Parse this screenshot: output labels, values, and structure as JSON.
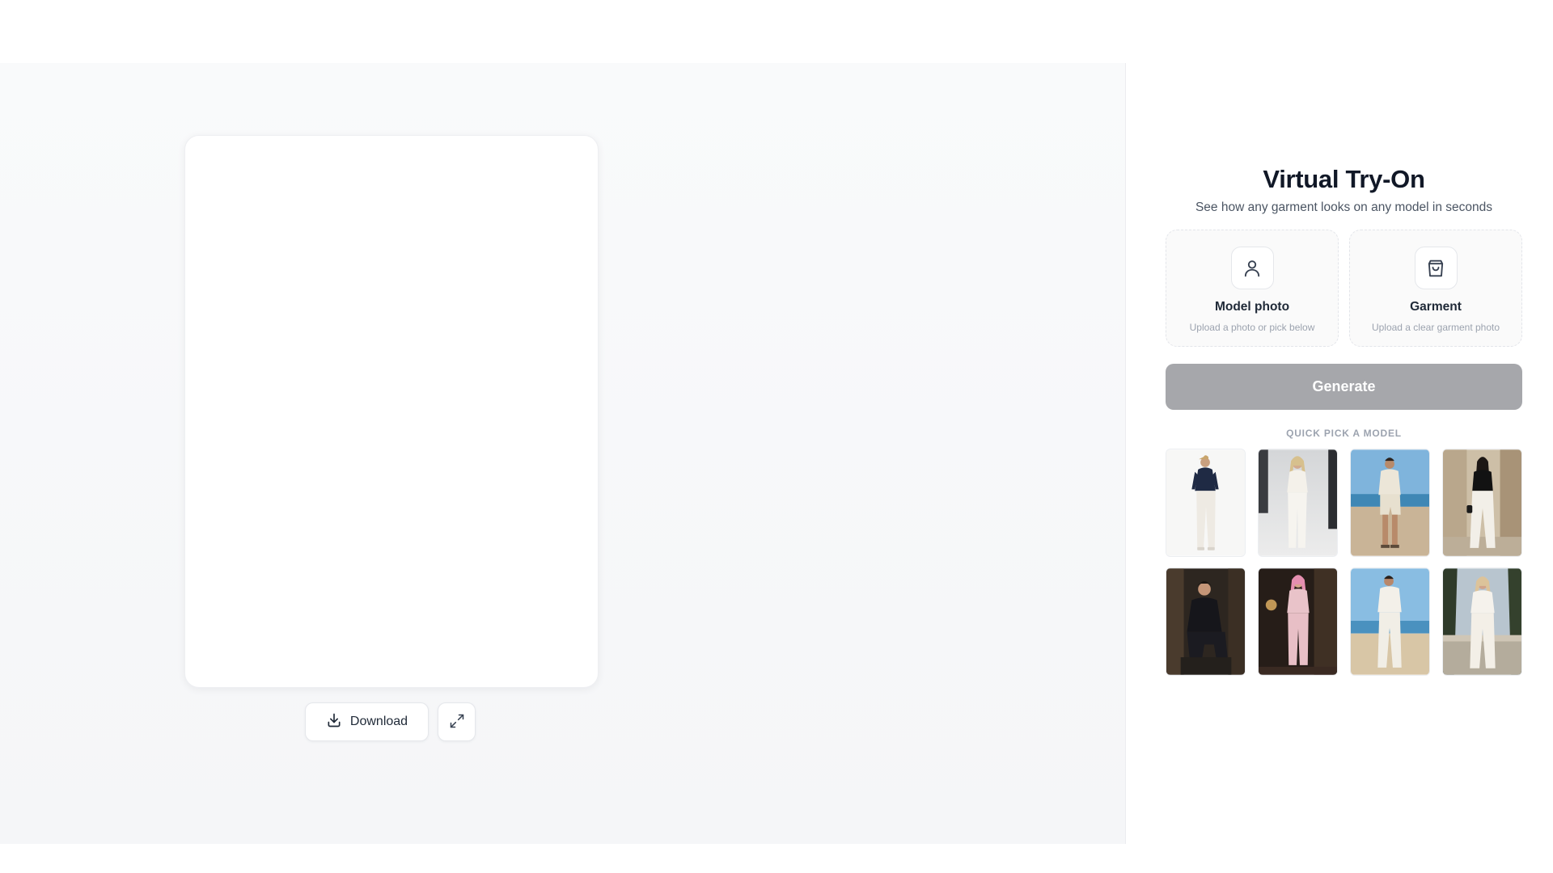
{
  "preview": {
    "download_label": "Download",
    "icons": {
      "download": "download-icon",
      "expand": "expand-icon"
    }
  },
  "panel": {
    "title": "Virtual Try-On",
    "subtitle": "See how any garment looks on any model in seconds",
    "uploads": [
      {
        "title": "Model photo",
        "subtitle": "Upload a photo or pick below",
        "icon": "user-icon"
      },
      {
        "title": "Garment",
        "subtitle": "Upload a clear garment photo",
        "icon": "shopping-bag-icon"
      }
    ],
    "generate_label": "Generate",
    "quick_pick_label": "QUICK PICK A MODEL",
    "models": [
      {
        "scene": "white studio",
        "top": "navy shirt",
        "bottom": "white trousers"
      },
      {
        "scene": "grey studio",
        "top": "white blouse",
        "bottom": "white trousers"
      },
      {
        "scene": "beach",
        "top": "cream shirt",
        "bottom": "cream shorts"
      },
      {
        "scene": "street",
        "top": "black top",
        "bottom": "white trousers"
      },
      {
        "scene": "dark interior",
        "top": "black suit",
        "bottom": "black trousers"
      },
      {
        "scene": "dark interior",
        "top": "pink blazer",
        "bottom": "pink trousers"
      },
      {
        "scene": "beach",
        "top": "white shirt",
        "bottom": "white trousers"
      },
      {
        "scene": "terrace",
        "top": "white top",
        "bottom": "white trousers"
      }
    ]
  },
  "colors": {
    "generate_disabled": "#a6a7ab",
    "panel_bg": "#ffffff",
    "preview_bg": "#f7f8fa"
  }
}
